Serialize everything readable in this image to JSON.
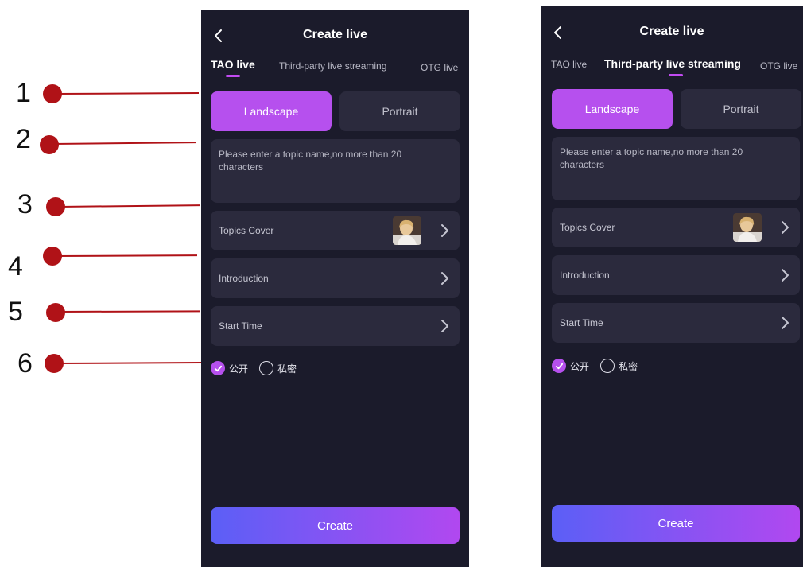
{
  "annotations": [
    "1",
    "2",
    "3",
    "4",
    "5",
    "6"
  ],
  "screens": [
    {
      "title": "Create live",
      "tabs": [
        "TAO live",
        "Third-party live streaming",
        "OTG live"
      ],
      "active_tab": 0,
      "orientation": {
        "landscape": "Landscape",
        "portrait": "Portrait",
        "selected": "landscape"
      },
      "topic_placeholder": "Please enter a topic name,no more than 20 characters",
      "rows": {
        "cover": "Topics Cover",
        "intro": "Introduction",
        "start": "Start Time"
      },
      "privacy": {
        "public": "公开",
        "private": "私密",
        "selected": "public"
      },
      "create_label": "Create"
    },
    {
      "title": "Create live",
      "tabs": [
        "TAO live",
        "Third-party live streaming",
        "OTG live"
      ],
      "active_tab": 1,
      "orientation": {
        "landscape": "Landscape",
        "portrait": "Portrait",
        "selected": "landscape"
      },
      "topic_placeholder": "Please enter a topic name,no more than 20 characters",
      "rows": {
        "cover": "Topics Cover",
        "intro": "Introduction",
        "start": "Start Time"
      },
      "privacy": {
        "public": "公开",
        "private": "私密",
        "selected": "public"
      },
      "create_label": "Create"
    }
  ],
  "colors": {
    "accent": "#b650ee",
    "background": "#1b1b2b",
    "card": "#2b2a3d",
    "annotation": "#b01217"
  },
  "icons": {
    "back": "chevron-left-icon",
    "chevron": "chevron-right-icon",
    "check": "check-circle-icon",
    "cover": "cover-thumbnail"
  }
}
